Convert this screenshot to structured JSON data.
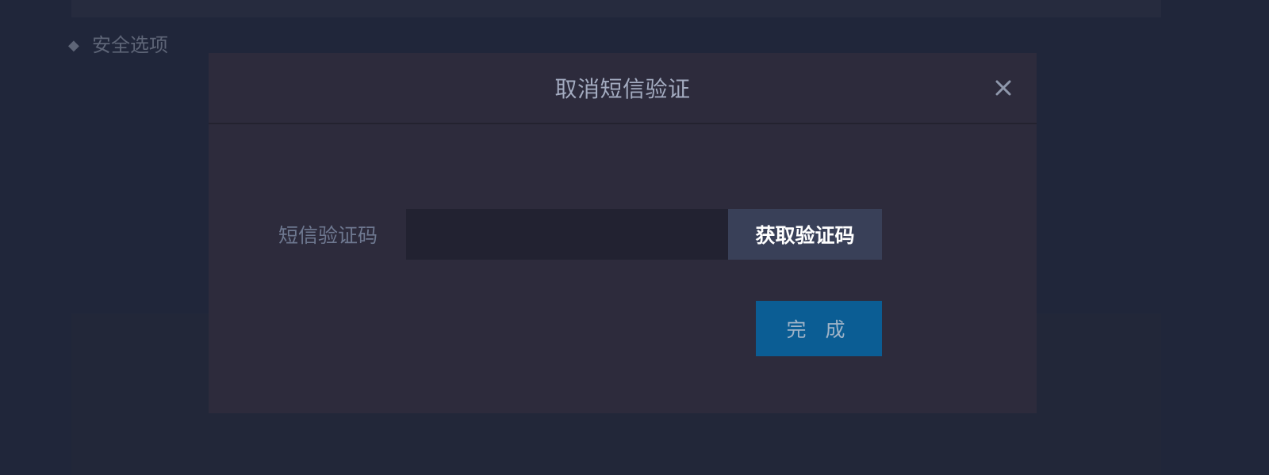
{
  "background": {
    "section_title": "安全选项"
  },
  "modal": {
    "title": "取消短信验证",
    "close_icon": "close-icon",
    "sms_code_label": "短信验证码",
    "sms_code_value": "",
    "sms_code_placeholder": "",
    "get_code_button": "获取验证码",
    "done_button": "完 成"
  },
  "colors": {
    "page_background": "#20263a",
    "modal_background": "#2d2b3c",
    "input_background": "#222231",
    "get_code_button_background": "#394058",
    "done_button_background": "#0b5d94"
  }
}
